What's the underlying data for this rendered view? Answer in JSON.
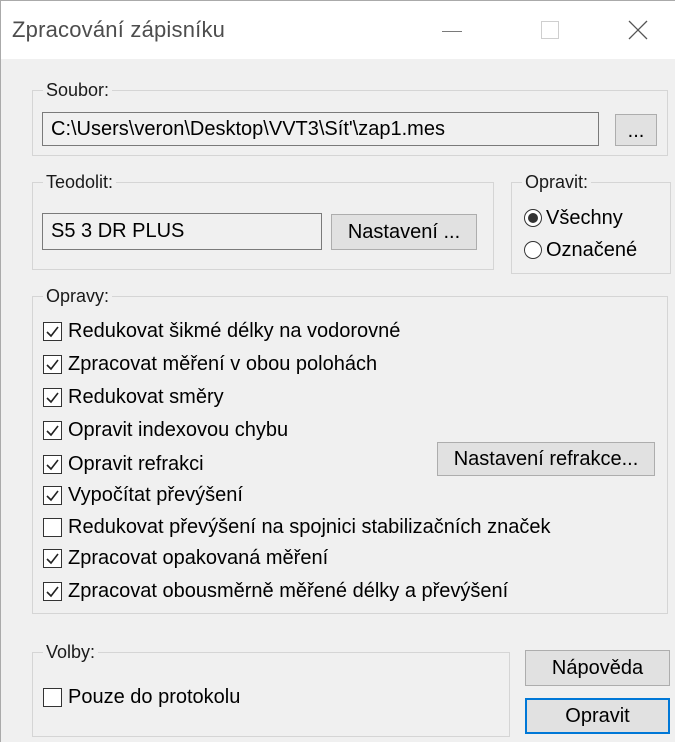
{
  "window": {
    "title": "Zpracování zápisníku"
  },
  "soubor": {
    "label": "Soubor:",
    "path": "C:\\Users\\veron\\Desktop\\VVT3\\Sít'\\zap1.mes",
    "browse_label": "..."
  },
  "teodolit": {
    "label": "Teodolit:",
    "value": "S5 3 DR PLUS",
    "settings_label": "Nastavení ..."
  },
  "opravit": {
    "label": "Opravit:",
    "options": [
      {
        "label": "Všechny",
        "checked": true
      },
      {
        "label": "Označené",
        "checked": false
      }
    ]
  },
  "opravy": {
    "label": "Opravy:",
    "refraction_button": "Nastavení refrakce...",
    "items": [
      {
        "label": "Redukovat šikmé délky na vodorovné",
        "checked": true
      },
      {
        "label": "Zpracovat měření v obou polohách",
        "checked": true
      },
      {
        "label": "Redukovat směry",
        "checked": true
      },
      {
        "label": "Opravit indexovou chybu",
        "checked": true
      },
      {
        "label": "Opravit refrakci",
        "checked": true
      },
      {
        "label": "Vypočítat převýšení",
        "checked": true
      },
      {
        "label": "Redukovat převýšení na spojnici stabilizačních značek",
        "checked": false
      },
      {
        "label": "Zpracovat opakovaná měření",
        "checked": true
      },
      {
        "label": "Zpracovat obousměrně měřené délky a převýšení",
        "checked": true
      }
    ]
  },
  "volby": {
    "label": "Volby:",
    "protocol_only": {
      "label": "Pouze do protokolu",
      "checked": false
    }
  },
  "buttons": {
    "help": "Nápověda",
    "apply": "Opravit"
  }
}
